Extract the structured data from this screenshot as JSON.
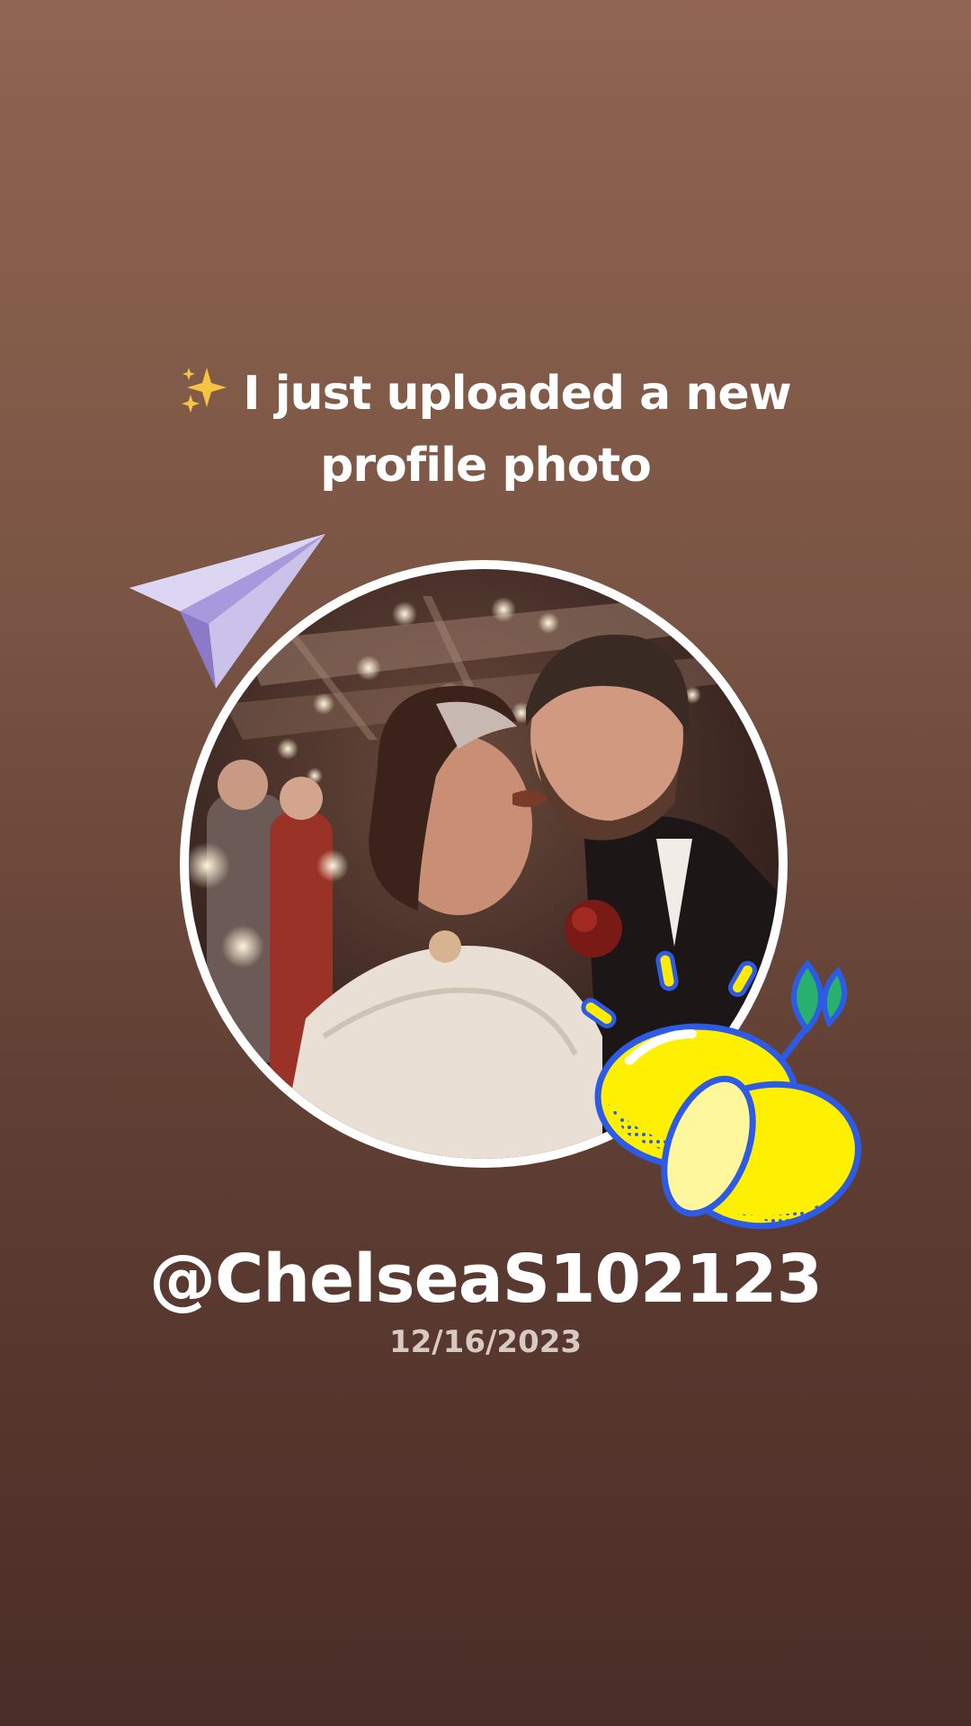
{
  "post": {
    "icon": "sparkles-icon",
    "headline_line1": "I just uploaded a new",
    "headline_line2": "profile photo",
    "username": "@ChelseaS102123",
    "date": "12/16/2023"
  },
  "stickers": {
    "top_left": "paper-plane-icon",
    "bottom_right": "lemon-icon"
  },
  "colors": {
    "background_top": "#906551",
    "background_bottom": "#4a2d27",
    "text": "#ffffff",
    "date_text": "#d8cac3",
    "frame": "#ffffff"
  }
}
